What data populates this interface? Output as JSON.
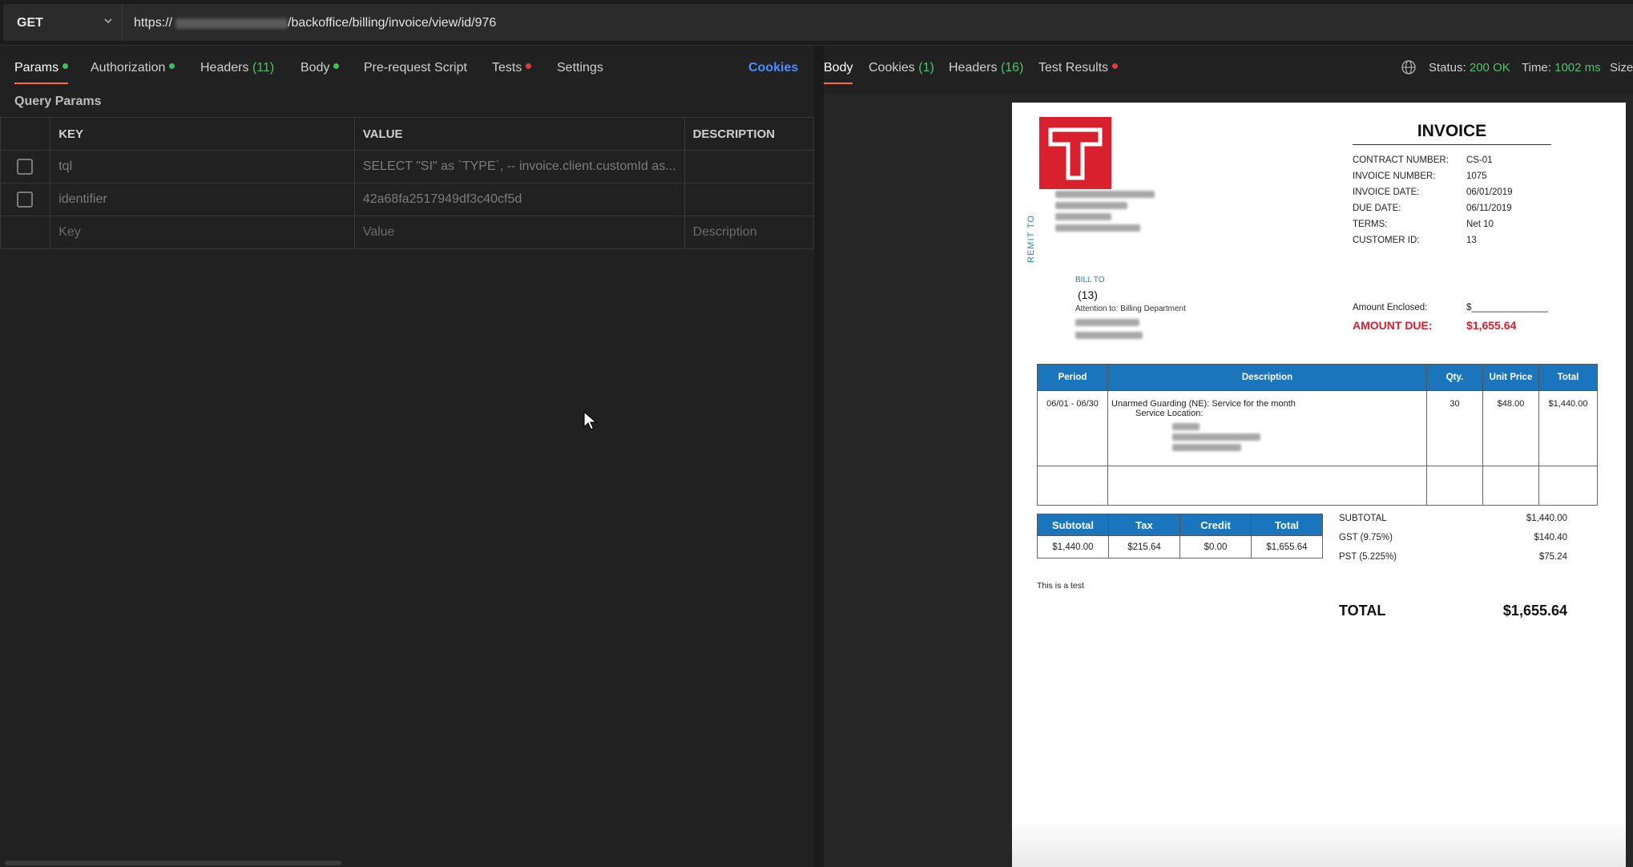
{
  "request": {
    "method": "GET",
    "url_prefix": "https://",
    "url_path": "/backoffice/billing/invoice/view/id/976"
  },
  "request_tabs": {
    "params": "Params",
    "authorization": "Authorization",
    "headers": "Headers",
    "headers_count": "(11)",
    "body": "Body",
    "pre_request": "Pre-request Script",
    "tests": "Tests",
    "settings": "Settings",
    "cookies": "Cookies"
  },
  "query_params": {
    "title": "Query Params",
    "columns": [
      "KEY",
      "VALUE",
      "DESCRIPTION"
    ],
    "rows": [
      {
        "key": "tql",
        "value": "SELECT \"SI\" as `TYPE`, -- invoice.client.customId as...",
        "description": ""
      },
      {
        "key": "identifier",
        "value": "42a68fa2517949df3c40cf5d",
        "description": ""
      }
    ],
    "placeholder": {
      "key": "Key",
      "value": "Value",
      "description": "Description"
    }
  },
  "response_tabs": {
    "body": "Body",
    "cookies": "Cookies",
    "cookies_count": "(1)",
    "headers": "Headers",
    "headers_count": "(16)",
    "test_results": "Test Results"
  },
  "response_status": {
    "status_label": "Status:",
    "status_value": "200 OK",
    "time_label": "Time:",
    "time_value": "1002 ms",
    "size_label": "Size"
  },
  "invoice": {
    "remit_to": "REMIT TO",
    "title": "INVOICE",
    "fields": [
      {
        "label": "CONTRACT NUMBER:",
        "value": "CS-01"
      },
      {
        "label": "INVOICE NUMBER:",
        "value": "1075"
      },
      {
        "label": "INVOICE DATE:",
        "value": "06/01/2019"
      },
      {
        "label": "DUE DATE:",
        "value": "06/11/2019"
      },
      {
        "label": "TERMS:",
        "value": "Net 10"
      },
      {
        "label": "CUSTOMER ID:",
        "value": "13"
      }
    ],
    "bill_to": "BILL TO",
    "bill_id": "(13)",
    "attention": "Attention to: Billing Department",
    "amount_enclosed_label": "Amount Enclosed:",
    "amount_enclosed_value": "$_______________",
    "amount_due_label": "AMOUNT DUE:",
    "amount_due_value": "$1,655.64",
    "items_columns": [
      "Period",
      "Description",
      "Qty.",
      "Unit Price",
      "Total"
    ],
    "item": {
      "period": "06/01 - 06/30",
      "description": "Unarmed Guarding (NE): Service for the month",
      "service_location": "Service Location:",
      "qty": "30",
      "unit_price": "$48.00",
      "total": "$1,440.00"
    },
    "summary_columns": [
      "Subtotal",
      "Tax",
      "Credit",
      "Total"
    ],
    "summary_values": [
      "$1,440.00",
      "$215.64",
      "$0.00",
      "$1,655.64"
    ],
    "totals": [
      {
        "label": "SUBTOTAL",
        "value": "$1,440.00"
      },
      {
        "label": "GST (9.75%)",
        "value": "$140.40"
      },
      {
        "label": "PST (5.225%)",
        "value": "$75.24"
      }
    ],
    "note": "This is a test",
    "grand_total_label": "TOTAL",
    "grand_total_value": "$1,655.64"
  },
  "colors": {
    "accent_orange": "#ff6c37",
    "status_green": "#4fc16b",
    "invoice_blue": "#1a75bc",
    "invoice_red": "#d8202e",
    "cookies_blue": "#4e8dff"
  }
}
